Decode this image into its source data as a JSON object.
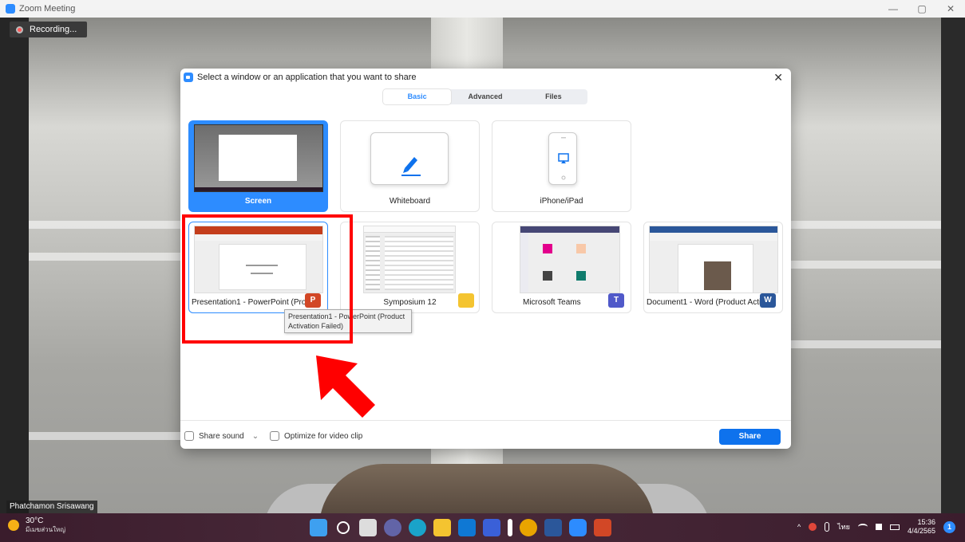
{
  "window": {
    "title": "Zoom Meeting",
    "minimize": "—",
    "restore": "▢",
    "close": "✕"
  },
  "recording": {
    "label": "Recording..."
  },
  "participant": {
    "name": "Phatchamon Srisawang"
  },
  "dialog": {
    "title": "Select a window or an application that you want to share",
    "close": "✕",
    "tabs": [
      {
        "label": "Basic",
        "active": true
      },
      {
        "label": "Advanced",
        "active": false
      },
      {
        "label": "Files",
        "active": false
      }
    ],
    "items": [
      {
        "label": "Screen",
        "selected": true
      },
      {
        "label": "Whiteboard"
      },
      {
        "label": "iPhone/iPad"
      },
      {
        "label": "Presentation1 - PowerPoint (Prod...",
        "app_icon": "P"
      },
      {
        "label": "Symposium 12",
        "app_icon": "folder-icon"
      },
      {
        "label": "Microsoft Teams",
        "app_icon": "T"
      },
      {
        "label": "Document1 - Word (Product Acti...",
        "app_icon": "W"
      }
    ],
    "tooltip": "Presentation1 - PowerPoint (Product Activation Failed)",
    "share_sound": "Share sound",
    "share_sound_dropdown": "⌄",
    "optimize": "Optimize for video clip",
    "share_button": "Share"
  },
  "taskbar": {
    "weather_temp": "30°C",
    "weather_desc": "มีเมฆส่วนใหญ่",
    "lang": "ไทย",
    "time": "15:36",
    "date": "4/4/2565",
    "notifications": "1",
    "tray_chevron": "^"
  },
  "colors": {
    "zoom_blue": "#2d8cff",
    "share_button": "#0e72ed",
    "highlight": "#ff0000"
  }
}
